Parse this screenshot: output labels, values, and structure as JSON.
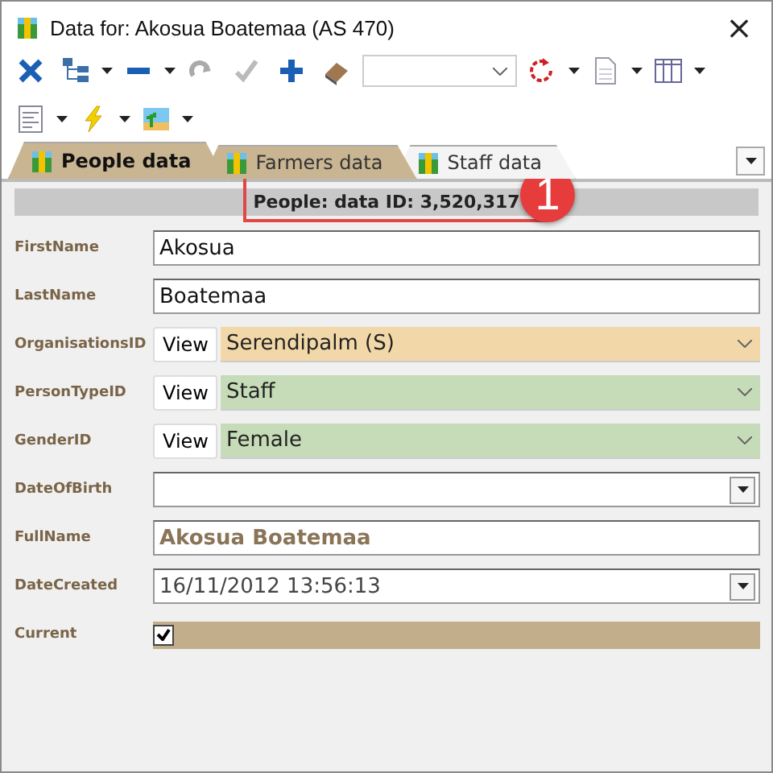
{
  "window": {
    "title": "Data for: Akosua Boatemaa (AS 470)",
    "close": "×"
  },
  "tabs": [
    {
      "label": "People data",
      "selected": true,
      "color": "#c9b592"
    },
    {
      "label": "Farmers data",
      "selected": false,
      "color": "#c9b592"
    },
    {
      "label": "Staff data",
      "selected": false,
      "color": "#f4f4f4"
    }
  ],
  "header": "People: data ID: 3,520,317",
  "callout": {
    "label": "1"
  },
  "fields": [
    {
      "label": "FirstName",
      "kind": "text",
      "value": "Akosua"
    },
    {
      "label": "LastName",
      "kind": "text",
      "value": "Boatemaa"
    },
    {
      "label": "OrganisationsID",
      "kind": "lookup",
      "button": "View",
      "value": "Serendipalm (S)",
      "color": "#f2d8a8"
    },
    {
      "label": "PersonTypeID",
      "kind": "lookup",
      "button": "View",
      "value": "Staff",
      "color": "#c6dcb8"
    },
    {
      "label": "GenderID",
      "kind": "lookup",
      "button": "View",
      "value": "Female",
      "color": "#c6dcb8"
    },
    {
      "label": "DateOfBirth",
      "kind": "date"
    },
    {
      "label": "FullName",
      "kind": "computed",
      "value": "Akosua Boatemaa"
    },
    {
      "label": "DateCreated",
      "kind": "date",
      "value": "16/11/2012 13:56:13"
    },
    {
      "label": "Current",
      "kind": "checkbox",
      "checked": true
    }
  ]
}
